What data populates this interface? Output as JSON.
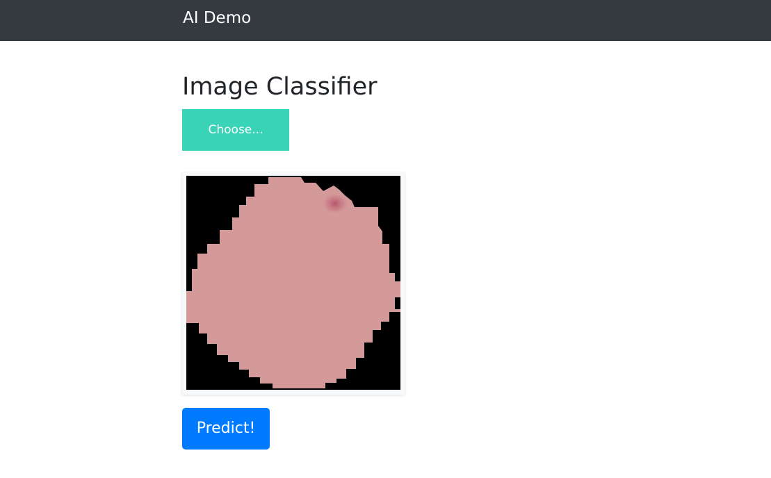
{
  "navbar": {
    "brand": "AI Demo",
    "background_color": "#343a40"
  },
  "main": {
    "title": "Image Classifier",
    "choose_button_label": "Choose...",
    "choose_button_color": "#39d3b7",
    "preview_image": {
      "description_icon": "cell-image",
      "background_color": "#000000",
      "cell_color": "#d49a9a"
    },
    "predict_button_label": "Predict!",
    "predict_button_color": "#007bff"
  }
}
